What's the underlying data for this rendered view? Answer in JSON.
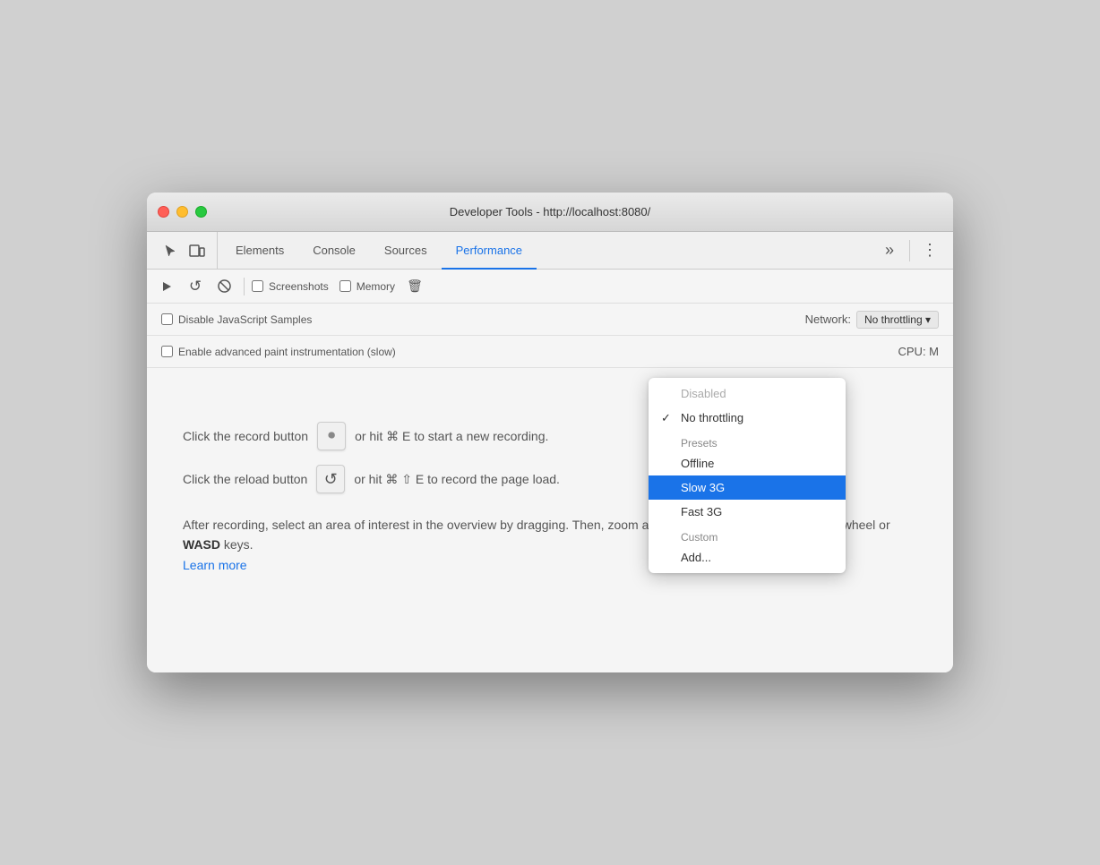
{
  "window": {
    "title": "Developer Tools - http://localhost:8080/",
    "traffic_lights": {
      "close_label": "close",
      "minimize_label": "minimize",
      "maximize_label": "maximize"
    }
  },
  "tabs": {
    "items": [
      {
        "id": "elements",
        "label": "Elements",
        "active": false
      },
      {
        "id": "console",
        "label": "Console",
        "active": false
      },
      {
        "id": "sources",
        "label": "Sources",
        "active": false
      },
      {
        "id": "performance",
        "label": "Performance",
        "active": true
      }
    ],
    "more_label": "»",
    "menu_label": "⋮"
  },
  "toolbar": {
    "record_icon": "▶",
    "reload_icon": "↺",
    "stop_icon": "⊘",
    "screenshots_label": "Screenshots",
    "memory_label": "Memory",
    "delete_icon": "🗑"
  },
  "settings": {
    "row1": {
      "checkbox_label": "Disable JavaScript Samples",
      "right_label": "Network:",
      "network_btn_label": "No throttling ▾"
    },
    "row2": {
      "checkbox_label": "Enable advanced paint instrumentation (slow)",
      "right_label": "CPU: M"
    }
  },
  "main": {
    "instruction1_before": "Click the record button",
    "instruction1_middle": "or hit ⌘ E to start a new recording.",
    "instruction1_icon": "⏺",
    "instruction2_before": "Click the reload button",
    "instruction2_middle": "or hit ⌘ ⇧ E to record the page load.",
    "instruction2_icon": "↺",
    "description": "After recording, select an area of interest in the overview by dragging.\nThen, zoom and pan the timeline with the mousewheel or ",
    "description_bold": "WASD",
    "description_end": " keys.",
    "learn_more_label": "Learn more",
    "learn_more_href": "#"
  },
  "dropdown": {
    "disabled_label": "Disabled",
    "no_throttling_label": "No throttling",
    "presets_label": "Presets",
    "offline_label": "Offline",
    "slow3g_label": "Slow 3G",
    "fast3g_label": "Fast 3G",
    "custom_label": "Custom",
    "add_label": "Add..."
  }
}
